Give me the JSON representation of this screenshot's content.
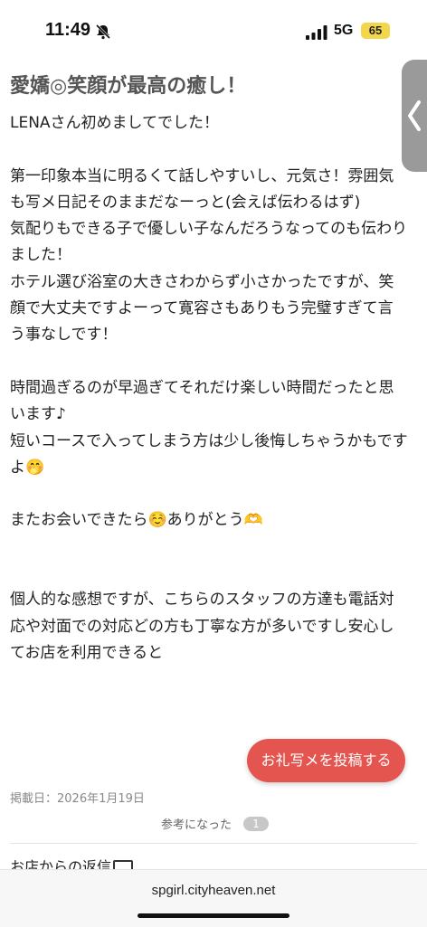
{
  "status_bar": {
    "time": "11:49",
    "network": "5G",
    "battery": "65",
    "icons": [
      "bell-slash-icon",
      "signal-icon"
    ]
  },
  "review": {
    "title": "愛嬌◎笑顔が最高の癒し！",
    "body": "LENAさん初めましてでした！\n\n第一印象本当に明るくて話しやすいし、元気さ！雰囲気も写メ日記そのままだなーっと(会えば伝わるはず)\n気配りもできる子で優しい子なんだろうなってのも伝わりました！\nホテル選び浴室の大きさわからず小さかったですが、笑顔で大丈夫ですよーって寛容さもありもう完璧すぎて言う事なしです！\n\n時間過ぎるのが早過ぎてそれだけ楽しい時間だったと思います♪\n短いコースで入ってしまう方は少し後悔しちゃうかもですよ🤭\n\nまたお会いできたら☺️ありがとう🫶\n\n\n個人的な感想ですが、こちらのスタッフの方達も電話対応や対面での対応どの方も丁寧な方が多いですし安心してお店を利用できると",
    "post_date": "掲載日：2026年1月19日",
    "helpful_label": "参考になった",
    "helpful_count": "1"
  },
  "post_photo_button": "お礼写メを投稿する",
  "shop_reply_label": "お店からの返信",
  "browser": {
    "url": "spgirl.cityheaven.net"
  },
  "colors": {
    "accent": "#e45550",
    "battery": "#f2d64b",
    "side_tab": "#9a9a9a"
  }
}
